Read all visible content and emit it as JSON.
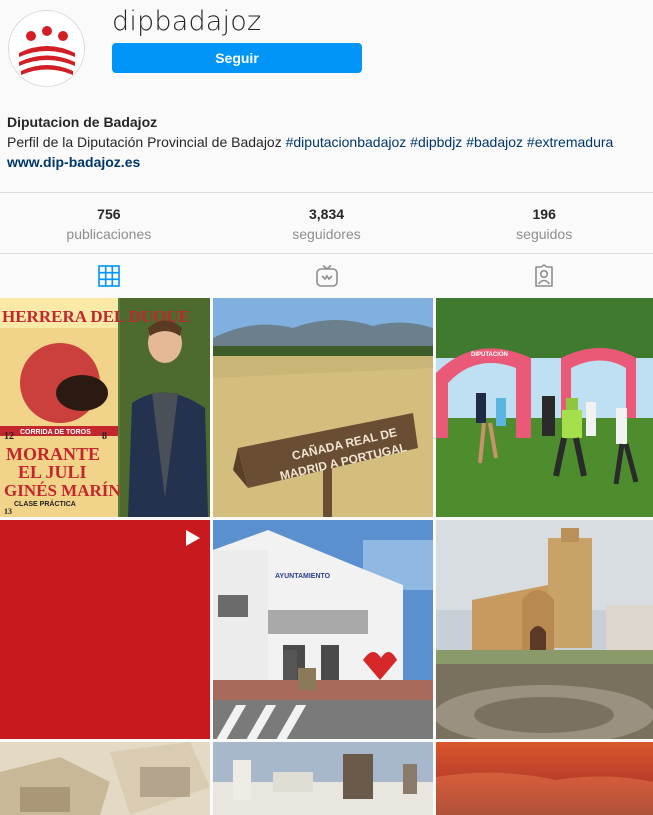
{
  "profile": {
    "username": "dipbadajoz",
    "follow_label": "Seguir",
    "display_name": "Diputacion de Badajoz",
    "bio_text": "Perfil de la Diputación Provincial de Badajoz ",
    "hashtags": [
      "#diputacionbadajoz",
      "#dipbdjz",
      "#badajoz",
      "#extremadura"
    ],
    "website": "www.dip-badajoz.es"
  },
  "stats": [
    {
      "value": "756",
      "label": "publicaciones"
    },
    {
      "value": "3,834",
      "label": "seguidores"
    },
    {
      "value": "196",
      "label": "seguidos"
    }
  ],
  "tabs": [
    {
      "icon": "grid-icon",
      "active": true
    },
    {
      "icon": "igtv-icon",
      "active": false
    },
    {
      "icon": "tagged-user-icon",
      "active": false
    }
  ],
  "posts": {
    "poster": {
      "title": "HERRERA DEL DUQUE",
      "event": "CORRIDA DE TOROS",
      "line1": "MORANTE",
      "line2": "EL JULI",
      "line3": "GINÉS MARÍN",
      "footer": "CLASE PRÁCTICA",
      "date_left_top": "12",
      "date_left_bottom": "13",
      "date_right": "8"
    },
    "sign": {
      "line1": "CAÑADA REAL DE",
      "line2": "MADRID A PORTUGAL"
    },
    "race_arch": "DIPUTACIÓN",
    "town_hall": "AYUNTAMIENTO"
  },
  "colors": {
    "accent": "#0095f6",
    "link": "#00376b",
    "muted": "#8e8e8e",
    "border": "#dbdbdb"
  }
}
